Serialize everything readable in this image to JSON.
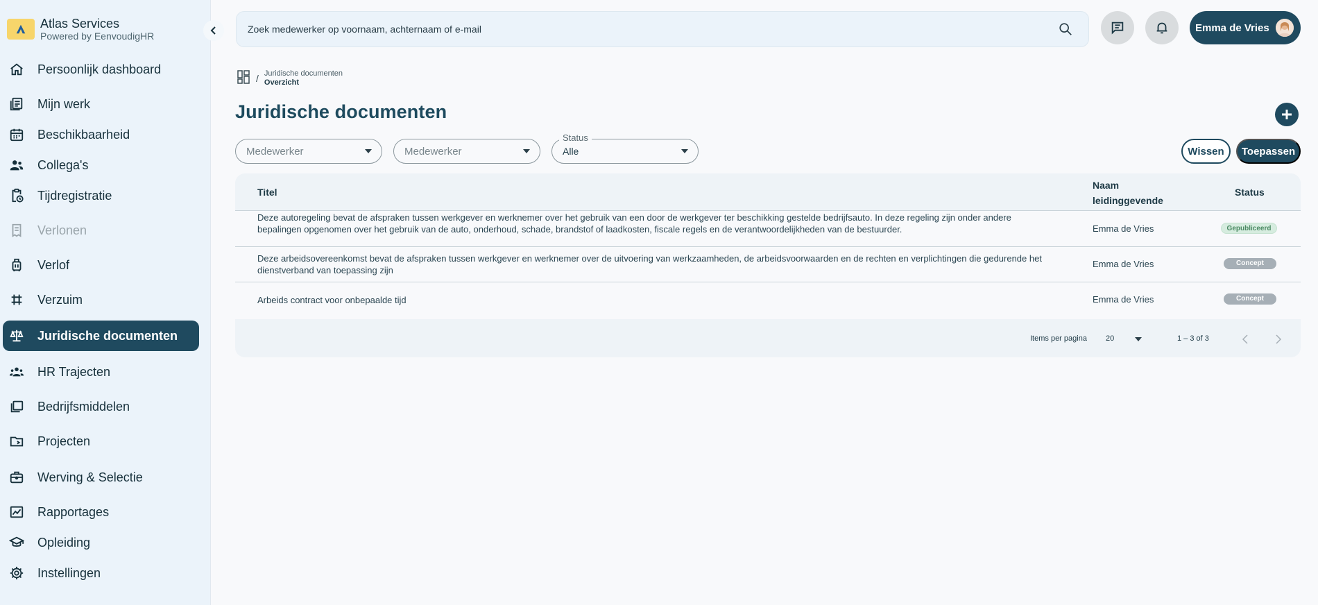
{
  "brand": {
    "title": "Atlas Services",
    "subtitle": "Powered by EenvoudigHR",
    "logo_color": "#f7d56b"
  },
  "sidebar": {
    "items": [
      {
        "label": "Persoonlijk dashboard",
        "icon": "home-icon",
        "state": "normal"
      },
      {
        "label": "Mijn werk",
        "icon": "document-list-icon",
        "state": "normal"
      },
      {
        "label": "Beschikbaarheid",
        "icon": "calendar-icon",
        "state": "normal"
      },
      {
        "label": "Collega's",
        "icon": "people-icon",
        "state": "normal"
      },
      {
        "label": "Tijdregistratie",
        "icon": "clipboard-clock-icon",
        "state": "normal"
      },
      {
        "label": "Verlonen",
        "icon": "receipt-icon",
        "state": "disabled"
      },
      {
        "label": "Verlof",
        "icon": "luggage-icon",
        "state": "normal"
      },
      {
        "label": "Verzuim",
        "icon": "bandage-icon",
        "state": "normal"
      },
      {
        "label": "Juridische documenten",
        "icon": "scales-icon",
        "state": "active"
      },
      {
        "label": "HR Trajecten",
        "icon": "group-icon",
        "state": "normal"
      },
      {
        "label": "Bedrijfsmiddelen",
        "icon": "stacked-files-icon",
        "state": "normal"
      },
      {
        "label": "Projecten",
        "icon": "folder-icon",
        "state": "normal"
      },
      {
        "label": "Werving & Selectie",
        "icon": "briefcase-icon",
        "state": "normal"
      },
      {
        "label": "Rapportages",
        "icon": "chart-icon",
        "state": "normal"
      },
      {
        "label": "Opleiding",
        "icon": "graduation-cap-icon",
        "state": "normal"
      },
      {
        "label": "Instellingen",
        "icon": "gear-icon",
        "state": "normal"
      }
    ]
  },
  "topbar": {
    "search_placeholder": "Zoek medewerker op voornaam, achternaam of e-mail",
    "user_name": "Emma de Vries"
  },
  "breadcrumb": {
    "parent": "Juridische documenten",
    "separator": "/",
    "current": "Overzicht"
  },
  "page": {
    "title": "Juridische documenten"
  },
  "filters": {
    "employee_placeholder_1": "Medewerker",
    "employee_placeholder_2": "Medewerker",
    "status_label": "Status",
    "status_value": "Alle",
    "clear_label": "Wissen",
    "apply_label": "Toepassen"
  },
  "table": {
    "headers": {
      "title": "Titel",
      "leader_line1": "Naam",
      "leader_line2": "leidinggevende",
      "status": "Status"
    },
    "rows": [
      {
        "title": "Deze autoregeling bevat de afspraken tussen werkgever en werknemer over het gebruik van een door de werkgever ter beschikking gestelde bedrijfsauto. In deze regeling zijn onder andere bepalingen opgenomen over het gebruik van de auto, onderhoud, schade, brandstof of laadkosten, fiscale regels en de verantwoordelijkheden van de bestuurder.",
        "leader": "Emma de Vries",
        "status": "Gepubliceerd"
      },
      {
        "title": "Deze arbeidsovereenkomst bevat de afspraken tussen werkgever en werknemer over de uitvoering van werkzaamheden, de arbeidsvoorwaarden en de rechten en verplichtingen die gedurende het dienstverband van toepassing zijn",
        "leader": "Emma de Vries",
        "status": "Concept"
      },
      {
        "title": "Arbeids contract voor onbepaalde tijd",
        "leader": "Emma de Vries",
        "status": "Concept"
      }
    ]
  },
  "pagination": {
    "items_per_page_label": "Items per pagina",
    "page_size": "20",
    "range": "1 – 3 of 3"
  },
  "colors": {
    "primary": "#1f4a5f",
    "sidebar_bg": "#ebf3fa",
    "published_badge": "#d6ecdf",
    "concept_badge": "#a6afb6"
  }
}
